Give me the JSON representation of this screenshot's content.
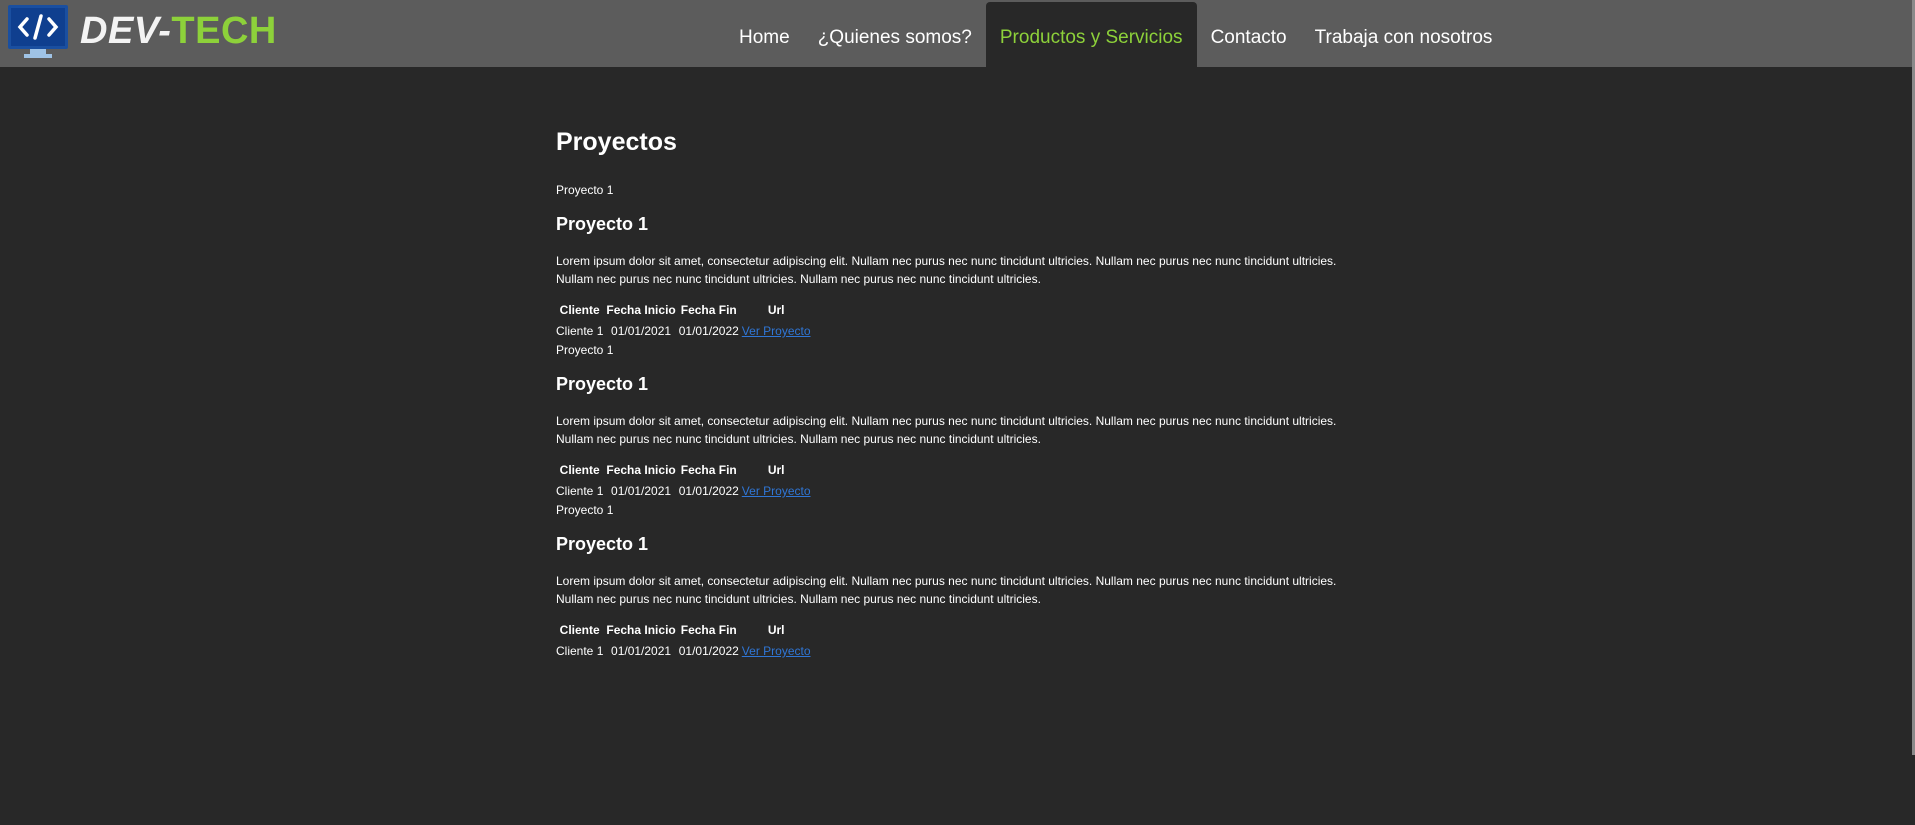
{
  "header": {
    "brand_part1": "DEV-",
    "brand_part2": "TECH",
    "logo_icon": "code-monitor-icon",
    "colors": {
      "accent": "#8dd13a",
      "bar": "#5c5c5c",
      "background": "#282828",
      "logo": "#1a4fa0"
    }
  },
  "nav": {
    "items": [
      {
        "label": "Home"
      },
      {
        "label": "¿Quienes somos?"
      },
      {
        "label": "Productos y Servicios",
        "active": true
      },
      {
        "label": "Contacto"
      },
      {
        "label": "Trabaja con nosotros"
      }
    ]
  },
  "page": {
    "title": "Proyectos"
  },
  "projects": [
    {
      "label": "Proyecto 1",
      "heading": "Proyecto 1",
      "description": "Lorem ipsum dolor sit amet, consectetur adipiscing elit. Nullam nec purus nec nunc tincidunt ultricies. Nullam nec purus nec nunc tincidunt ultricies. Nullam nec purus nec nunc tincidunt ultricies. Nullam nec purus nec nunc tincidunt ultricies.",
      "table": {
        "headers": [
          "Cliente",
          "Fecha Inicio",
          "Fecha Fin",
          "Url"
        ],
        "row": {
          "cliente": "Cliente 1",
          "inicio": "01/01/2021",
          "fin": "01/01/2022",
          "url": "Ver Proyecto"
        }
      }
    },
    {
      "label": "Proyecto 1",
      "heading": "Proyecto 1",
      "description": "Lorem ipsum dolor sit amet, consectetur adipiscing elit. Nullam nec purus nec nunc tincidunt ultricies. Nullam nec purus nec nunc tincidunt ultricies. Nullam nec purus nec nunc tincidunt ultricies. Nullam nec purus nec nunc tincidunt ultricies.",
      "table": {
        "headers": [
          "Cliente",
          "Fecha Inicio",
          "Fecha Fin",
          "Url"
        ],
        "row": {
          "cliente": "Cliente 1",
          "inicio": "01/01/2021",
          "fin": "01/01/2022",
          "url": "Ver Proyecto"
        }
      }
    },
    {
      "label": "Proyecto 1",
      "heading": "Proyecto 1",
      "description": "Lorem ipsum dolor sit amet, consectetur adipiscing elit. Nullam nec purus nec nunc tincidunt ultricies. Nullam nec purus nec nunc tincidunt ultricies. Nullam nec purus nec nunc tincidunt ultricies. Nullam nec purus nec nunc tincidunt ultricies.",
      "table": {
        "headers": [
          "Cliente",
          "Fecha Inicio",
          "Fecha Fin",
          "Url"
        ],
        "row": {
          "cliente": "Cliente 1",
          "inicio": "01/01/2021",
          "fin": "01/01/2022",
          "url": "Ver Proyecto"
        }
      }
    }
  ]
}
